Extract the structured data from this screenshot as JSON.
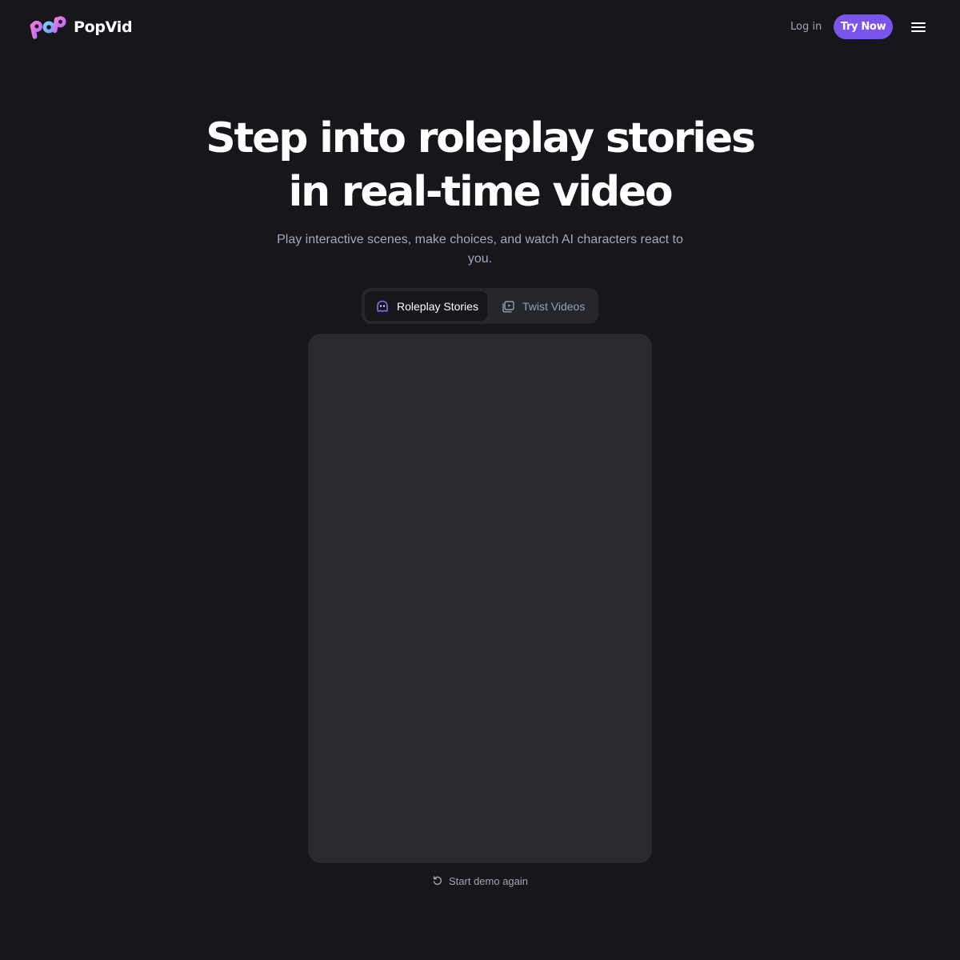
{
  "header": {
    "logo_icon": "pop-logo-icon",
    "brand_name": "PopVid",
    "login_label": "Log in",
    "cta_label": "Try Now",
    "menu_icon": "hamburger-menu-icon"
  },
  "hero": {
    "title_line1": "Step into roleplay stories",
    "title_line2": "in real-time video",
    "subtitle": "Play interactive scenes, make choices, and watch AI characters react to you."
  },
  "tabs": [
    {
      "label": "Roleplay Stories",
      "icon": "ghost-face-icon",
      "active": true
    },
    {
      "label": "Twist Videos",
      "icon": "video-stack-icon",
      "active": false
    }
  ],
  "demo": {
    "restart_label": "Start demo again",
    "restart_icon": "rotate-ccw-icon"
  },
  "colors": {
    "background": "#17171b",
    "accent": "#7a55ec",
    "card": "#29292e",
    "tabs_bg": "#26272c",
    "muted_text": "#a1a5b3"
  }
}
